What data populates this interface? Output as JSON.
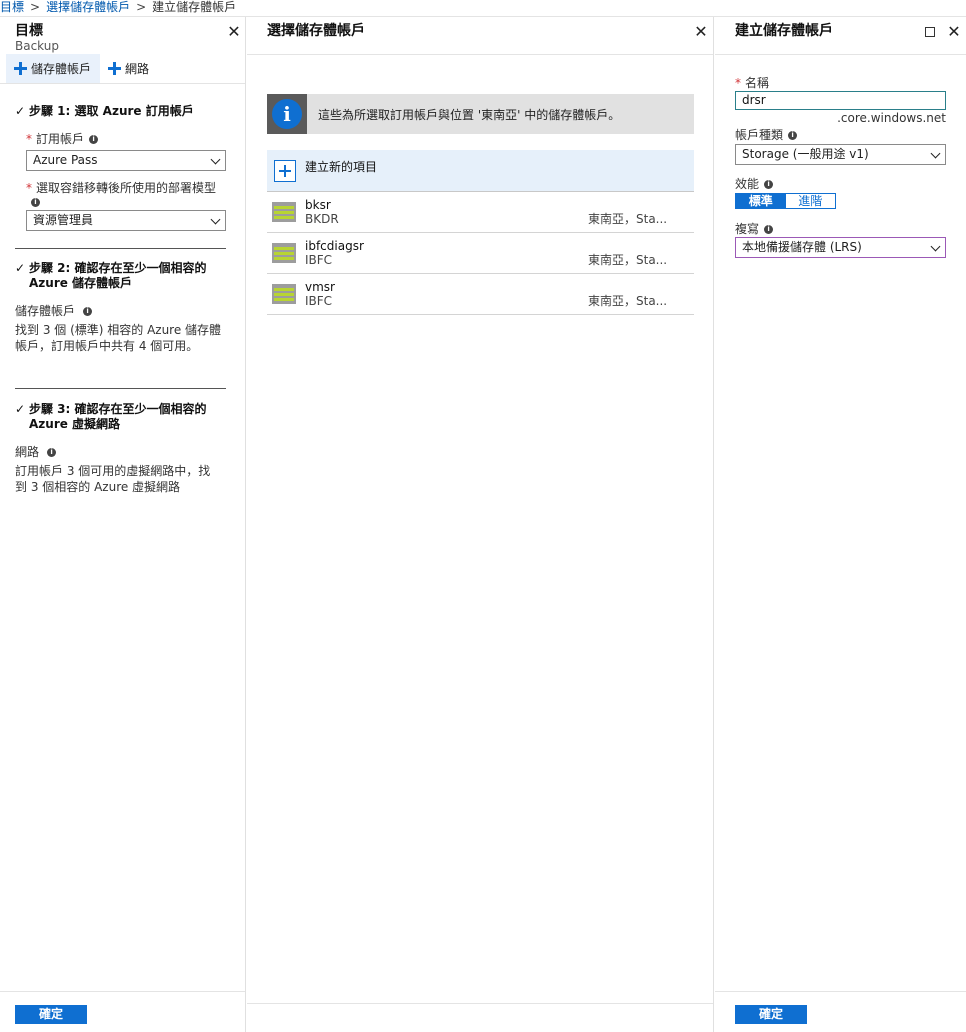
{
  "breadcrumb": {
    "items": [
      "目標",
      "選擇儲存體帳戶",
      "建立儲存體帳戶"
    ]
  },
  "blade1": {
    "title": "目標",
    "subtitle": "Backup",
    "commands": [
      "儲存體帳戶",
      "網路"
    ],
    "step1": {
      "heading": "步驟 1: 選取 Azure 訂用帳戶",
      "subscription_label": "訂用帳戶",
      "subscription_value": "Azure Pass",
      "deploy_label": "選取容錯移轉後所使用的部署模型",
      "deploy_value": "資源管理員"
    },
    "step2": {
      "heading_line1": "步驟 2: 確認存在至少一個相容的",
      "heading_line2": "Azure 儲存體帳戶",
      "label": "儲存體帳戶",
      "text_line1": "找到 3 個 (標準) 相容的 Azure 儲存體",
      "text_line2": "帳戶，訂用帳戶中共有 4 個可用。"
    },
    "step3": {
      "heading_line1": "步驟 3: 確認存在至少一個相容的",
      "heading_line2": "Azure 虛擬網路",
      "label": "網路",
      "text_line1": "訂用帳戶 3 個可用的虛擬網路中，找",
      "text_line2": "到 3 個相容的 Azure 虛擬網路"
    },
    "ok_label": "確定"
  },
  "blade2": {
    "title": "選擇儲存體帳戶",
    "info_text": "這些為所選取訂用帳戶與位置 '東南亞' 中的儲存體帳戶。",
    "create_new_label": "建立新的項目",
    "accounts": [
      {
        "name": "bksr",
        "group": "BKDR",
        "location": "東南亞，Sta..."
      },
      {
        "name": "ibfcdiagsr",
        "group": "IBFC",
        "location": "東南亞，Sta..."
      },
      {
        "name": "vmsr",
        "group": "IBFC",
        "location": "東南亞，Sta..."
      }
    ]
  },
  "blade3": {
    "title": "建立儲存體帳戶",
    "name_label": "名稱",
    "name_value": "drsr",
    "name_suffix": ".core.windows.net",
    "kind_label": "帳戶種類",
    "kind_value": "Storage (一般用途 v1)",
    "perf_label": "效能",
    "perf_options": [
      "標準",
      "進階"
    ],
    "perf_selected": "標準",
    "repl_label": "複寫",
    "repl_value": "本地備援儲存體 (LRS)",
    "ok_label": "確定"
  },
  "colors": {
    "accent": "#0f6fd1",
    "link": "#0058ad",
    "required": "#d13438"
  },
  "icons": {
    "close": "close-icon",
    "maximize": "maximize-icon",
    "info": "info-icon",
    "storage": "storage-account-icon"
  }
}
